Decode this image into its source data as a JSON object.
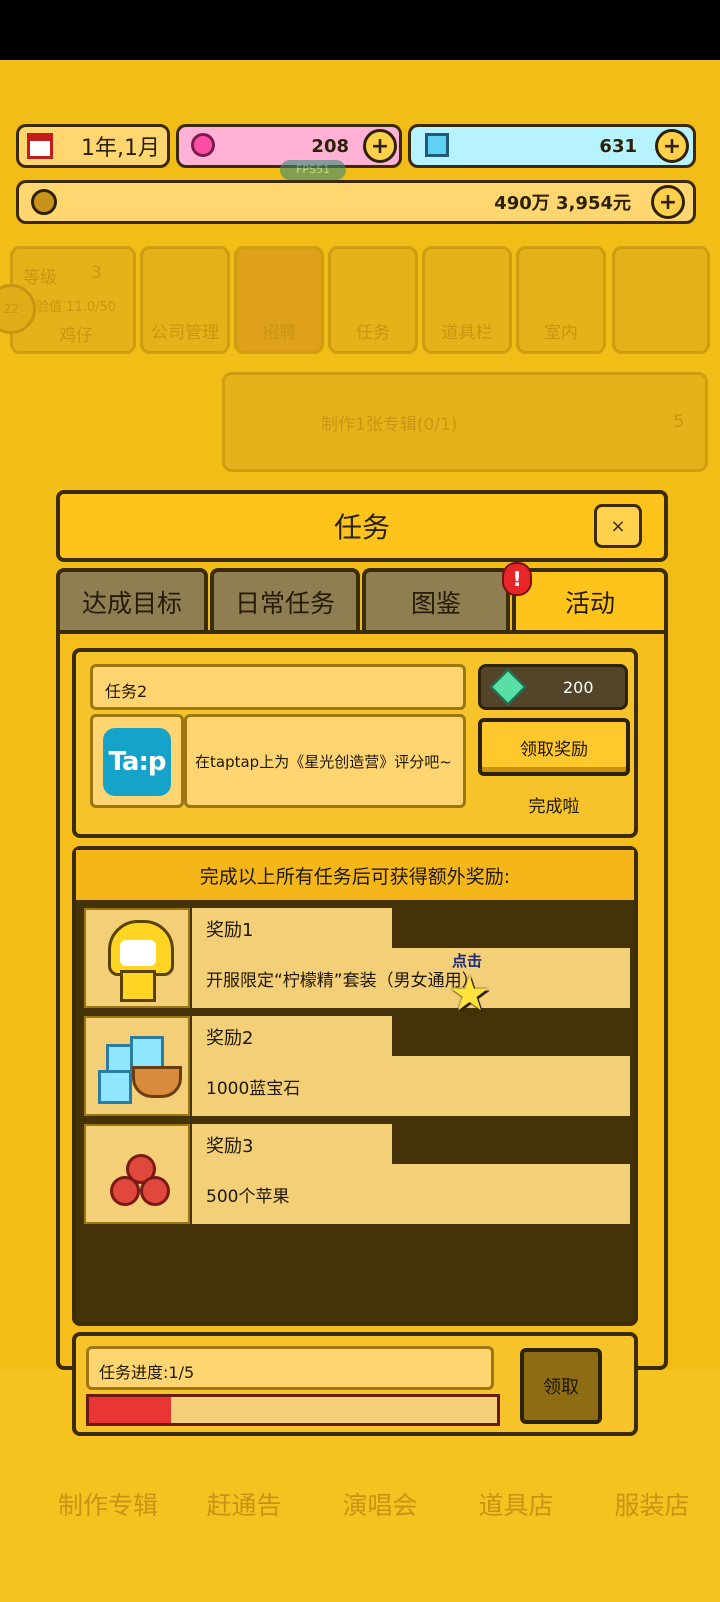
{
  "topbar": {
    "date": "1年,1月",
    "pink_gems": "208",
    "blue_gems": "631",
    "money": "490万 3,954元",
    "fps": "FPS51"
  },
  "background": {
    "level_label": "等级",
    "level_value": "3",
    "exp_label": "经验值",
    "exp_value": "11.0/50",
    "player_name": "鸡仔",
    "avatar_level": "22",
    "menu": [
      "公司管理",
      "招聘",
      "任务",
      "道具栏",
      "室内"
    ],
    "quest_text": "制作1张专辑(0/1)",
    "quest_reward": "5"
  },
  "dialog": {
    "title": "任务",
    "close": "×",
    "tabs": [
      "达成目标",
      "日常任务",
      "图鉴",
      "活动"
    ],
    "badge": "!",
    "task": {
      "name": "任务2",
      "icon_text": "Ta:p",
      "description": "在taptap上为《星光创造营》评分吧~",
      "reward_amount": "200",
      "claim_label": "领取奖励",
      "status": "完成啦"
    },
    "bonus_header": "完成以上所有任务后可获得额外奖励:",
    "rewards": [
      {
        "title": "奖励1",
        "body": "开服限定“柠檬精”套装（男女通用）"
      },
      {
        "title": "奖励2",
        "body": "1000蓝宝石"
      },
      {
        "title": "奖励3",
        "body": "500个苹果"
      }
    ],
    "progress_label": "任务进度:1/5",
    "progress_fraction": 0.2,
    "collect_label": "领取",
    "hint_label": "点击"
  },
  "bottom_nav": [
    "制作专辑",
    "赶通告",
    "演唱会",
    "道具店",
    "服装店"
  ],
  "colors": {
    "background": "#f1bd16",
    "progress_fill": "#ea3535",
    "taptap": "#15a3c9"
  }
}
